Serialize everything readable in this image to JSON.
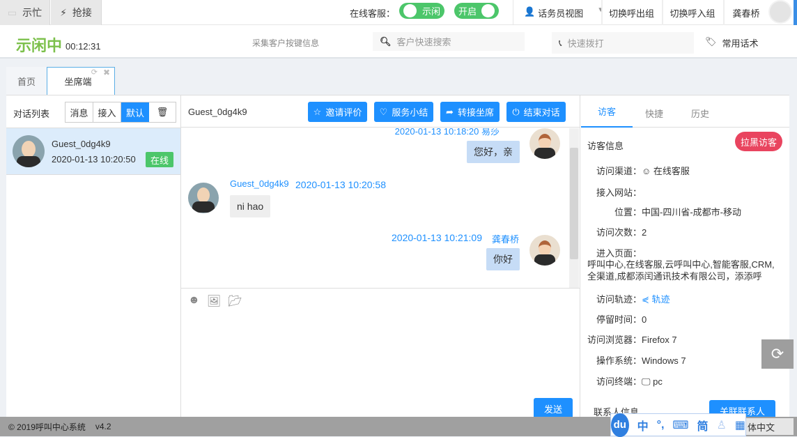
{
  "topbar": {
    "busy": "示忙",
    "grab": "抢接",
    "online_label": "在线客服：",
    "toggle1": "示闲",
    "toggle2": "开启",
    "view": "话务员视图",
    "switch_out": "切换呼出组",
    "switch_in": "切换呼入组",
    "user": "龚春桥"
  },
  "status": {
    "state": "示闲中",
    "timer": "00:12:31",
    "collect": "采集客户按键信息",
    "search_placeholder": "客户快速搜索",
    "dial_placeholder": "快速拨打",
    "phrases": "常用话术"
  },
  "tabs": [
    {
      "label": "首页"
    },
    {
      "label": "坐席端"
    }
  ],
  "left": {
    "title": "对话列表",
    "btns": [
      "消息",
      "接入",
      "默认"
    ],
    "session": {
      "name": "Guest_0dg4k9",
      "time": "2020-01-13 10:20:50",
      "badge": "在线"
    }
  },
  "chat": {
    "guest": "Guest_0dg4k9",
    "actions": [
      "邀请评价",
      "服务小结",
      "转接坐席",
      "结束对话"
    ],
    "messages": [
      {
        "meta": "2020-01-13 10:18:20  易莎",
        "text": "您好，亲"
      },
      {
        "name": "Guest_0dg4k9",
        "time": "2020-01-13 10:20:58",
        "text": "ni hao"
      },
      {
        "time": "2020-01-13 10:21:09",
        "name": "龚春桥",
        "text": "你好"
      }
    ],
    "send": "发送"
  },
  "right": {
    "tabs": [
      "访客",
      "快捷",
      "历史"
    ],
    "visitor_info": "访客信息",
    "blacklist": "拉黑访客",
    "fields": [
      {
        "label": "访问渠道：",
        "value": "在线客服"
      },
      {
        "label": "接入网站：",
        "value": ""
      },
      {
        "label": "位置：",
        "value": "中国-四川省-成都市-移动"
      },
      {
        "label": "访问次数：",
        "value": "2"
      },
      {
        "label": "进入页面：",
        "value": "呼叫中心,在线客服,云呼叫中心,智能客服,CRM,全渠道,成都添闰通讯技术有限公司，添添呼"
      },
      {
        "label": "访问轨迹：",
        "value": "轨迹"
      },
      {
        "label": "停留时间：",
        "value": "0"
      },
      {
        "label": "访问浏览器：",
        "value": "Firefox 7"
      },
      {
        "label": "操作系统：",
        "value": "Windows 7"
      },
      {
        "label": "访问终端：",
        "value": "pc"
      }
    ],
    "contact": "联系人信息",
    "link_contact": "关联联系人"
  },
  "footer": {
    "copyright": "© 2019呼叫中心系统",
    "version": "v4.2"
  },
  "ime": {
    "items": [
      "中",
      "°,",
      "简"
    ],
    "lang": "体中文"
  }
}
